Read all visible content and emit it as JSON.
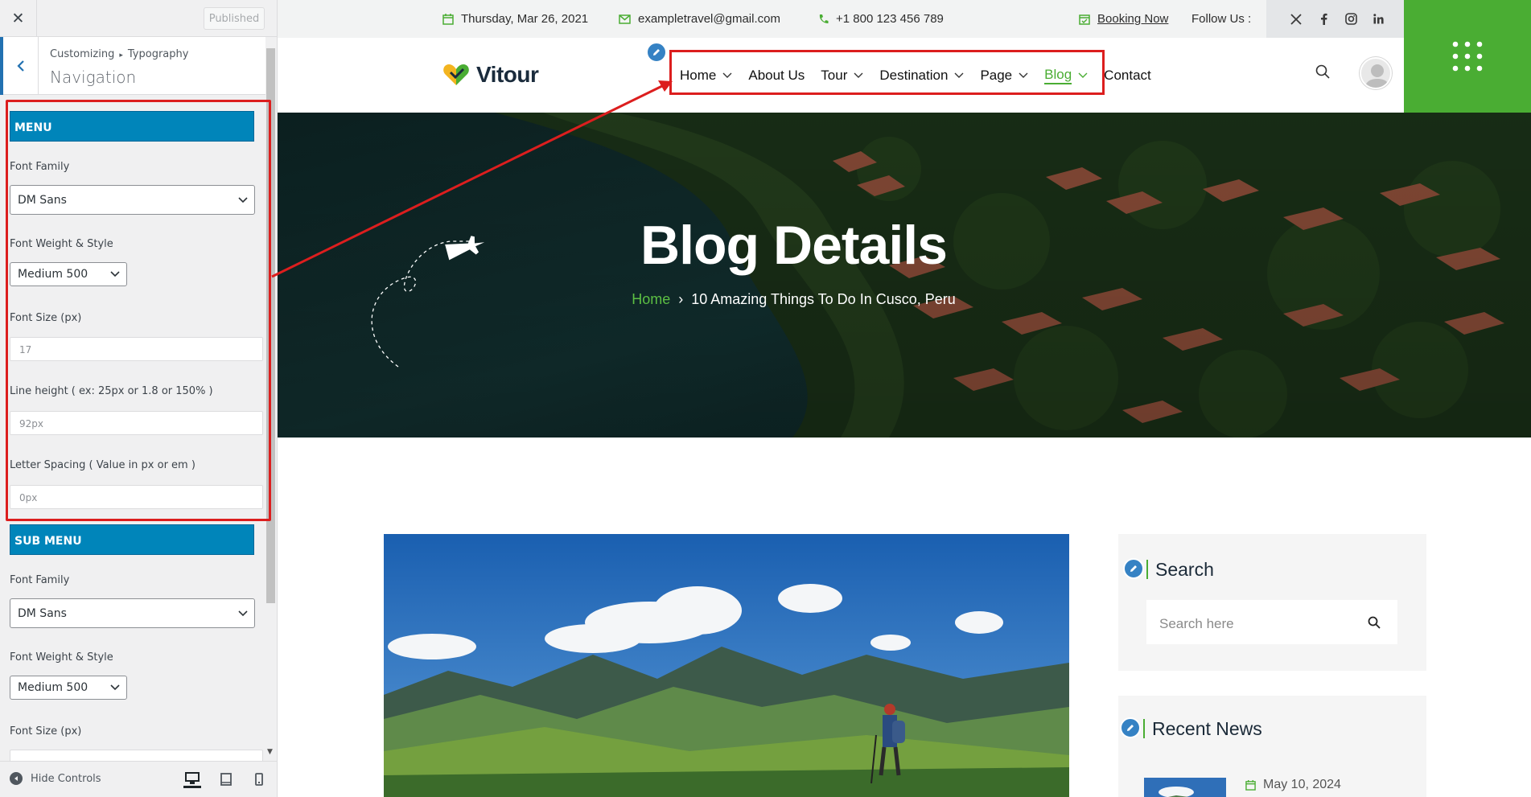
{
  "customizer": {
    "close_glyph": "✕",
    "published_label": "Published",
    "breadcrumb_root": "Customizing",
    "breadcrumb_sep": "▸",
    "breadcrumb_leaf": "Typography",
    "section_title": "Navigation",
    "menu_section": {
      "title": "MENU",
      "font_family_label": "Font Family",
      "font_family_value": "DM Sans",
      "font_weight_label": "Font Weight & Style",
      "font_weight_value": "Medium 500",
      "font_size_label": "Font Size (px)",
      "font_size_value": "17",
      "line_height_label": "Line height ( ex: 25px or 1.8 or 150% )",
      "line_height_value": "92px",
      "letter_spacing_label": "Letter Spacing ( Value in px or em )",
      "letter_spacing_value": "0px"
    },
    "submenu_section": {
      "title": "SUB MENU",
      "font_family_label": "Font Family",
      "font_family_value": "DM Sans",
      "font_weight_label": "Font Weight & Style",
      "font_weight_value": "Medium 500",
      "font_size_label": "Font Size (px)"
    },
    "hide_controls_label": "Hide Controls",
    "accent_color": "#0085ba",
    "highlight_color": "#dc1e1e"
  },
  "site": {
    "topbar": {
      "date": "Thursday, Mar 26, 2021",
      "email": "exampletravel@gmail.com",
      "phone": "+1 800 123 456 789",
      "booking": "Booking Now",
      "follow": "Follow Us :",
      "social_icons": [
        "x-icon",
        "facebook-icon",
        "instagram-icon",
        "linkedin-icon"
      ]
    },
    "logo_text": "Vitour",
    "nav": [
      {
        "label": "Home",
        "dropdown": true
      },
      {
        "label": "About Us",
        "dropdown": false
      },
      {
        "label": "Tour",
        "dropdown": true
      },
      {
        "label": "Destination",
        "dropdown": true
      },
      {
        "label": "Page",
        "dropdown": true
      },
      {
        "label": "Blog",
        "dropdown": true,
        "active": true
      },
      {
        "label": "Contact",
        "dropdown": false
      }
    ],
    "hero": {
      "title": "Blog Details",
      "crumb_home": "Home",
      "crumb_sep": "›",
      "crumb_current": "10 Amazing Things To Do In Cusco, Peru"
    },
    "sidebar": {
      "search_title": "Search",
      "search_placeholder": "Search here",
      "recent_title": "Recent News",
      "recent_date": "May 10, 2024"
    },
    "brand_green": "#4aad33"
  }
}
